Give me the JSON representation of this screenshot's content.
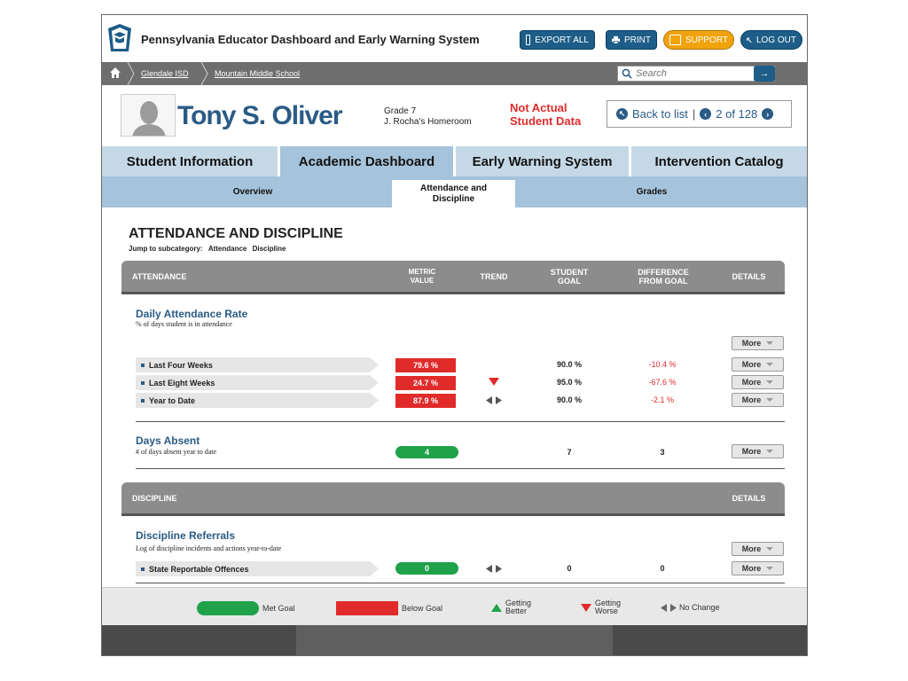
{
  "header": {
    "app_title": "Pennsylvania Educator Dashboard and Early Warning System",
    "export_label": "EXPORT ALL",
    "print_label": "PRINT",
    "support_label": "SUPPORT",
    "logout_label": "LOG OUT"
  },
  "breadcrumb": {
    "items": [
      "Glendale ISD",
      "Mountain Middle School"
    ]
  },
  "search": {
    "placeholder": "Search",
    "go_glyph": "→"
  },
  "student": {
    "name": "Tony S. Oliver",
    "grade": "Grade 7",
    "homeroom": "J. Rocha's Homeroom",
    "not_actual_line1": "Not Actual",
    "not_actual_line2": "Student Data",
    "back_label": "Back to list",
    "position": "2 of 128"
  },
  "main_tabs": [
    "Student Information",
    "Academic Dashboard",
    "Early Warning System",
    "Intervention Catalog"
  ],
  "main_tab_active": "Academic Dashboard",
  "sub_tabs": {
    "overview": "Overview",
    "attendance_line1": "Attendance and",
    "attendance_line2": "Discipline",
    "grades": "Grades"
  },
  "section": {
    "title": "ATTENDANCE AND DISCIPLINE",
    "jump_label": "Jump to subcategory:",
    "jump_links": [
      "Attendance",
      "Discipline"
    ]
  },
  "attendance_table": {
    "header": {
      "name": "ATTENDANCE",
      "metric_l1": "METRIC",
      "metric_l2": "VALUE",
      "trend": "TREND",
      "goal_l1": "STUDENT",
      "goal_l2": "GOAL",
      "diff_l1": "DIFFERENCE",
      "diff_l2": "FROM GOAL",
      "details": "DETAILS"
    },
    "daily": {
      "title": "Daily Attendance Rate",
      "desc": "% of days student is in attendance",
      "rows": [
        {
          "label": "Last Four Weeks",
          "value": "79.6 %",
          "trend": "none",
          "goal": "90.0 %",
          "diff": "-10.4 %"
        },
        {
          "label": "Last Eight Weeks",
          "value": "24.7 %",
          "trend": "worse",
          "goal": "95.0 %",
          "diff": "-67.6 %"
        },
        {
          "label": "Year to Date",
          "value": "87.9 %",
          "trend": "nochange",
          "goal": "90.0 %",
          "diff": "-2.1 %"
        }
      ]
    },
    "absent": {
      "title": "Days Absent",
      "desc": "# of days absent year to date",
      "value": "4",
      "goal": "7",
      "diff": "3"
    }
  },
  "discipline_table": {
    "header": {
      "name": "DISCIPLINE",
      "details": "DETAILS"
    },
    "title": "Discipline Referrals",
    "desc": "Log of discipline incidents and actions year-to-date",
    "rows": [
      {
        "label": "State Reportable Offences",
        "value": "0",
        "trend": "nochange",
        "goal": "0",
        "diff": "0"
      }
    ]
  },
  "more_label": "More",
  "legend": {
    "met": "Met Goal",
    "below": "Below Goal",
    "better_l1": "Getting",
    "better_l2": "Better",
    "worse_l1": "Getting",
    "worse_l2": "Worse",
    "nochange": "No Change"
  },
  "colors": {
    "brand_blue": "#2a5b86",
    "below_red": "#e12b2b",
    "met_green": "#1fa24a",
    "support_orange": "#f0a30c"
  }
}
